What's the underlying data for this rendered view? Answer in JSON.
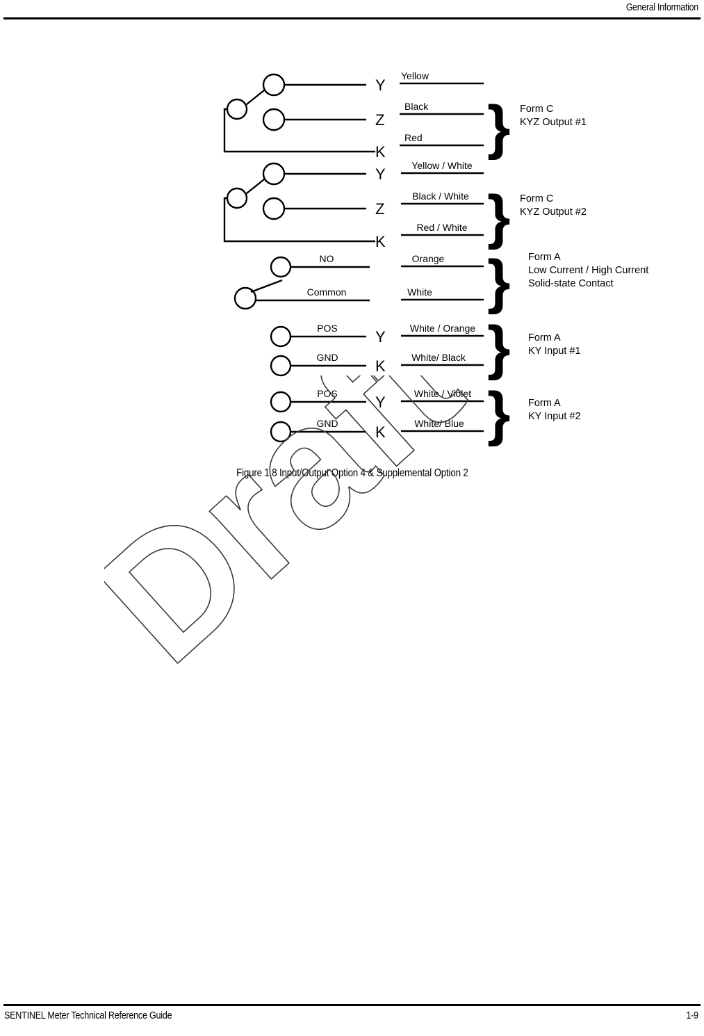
{
  "page": {
    "header_title": "General Information",
    "footer_left": "SENTINEL Meter Technical Reference Guide",
    "footer_page": "1-9",
    "watermark": "Draft"
  },
  "figure": {
    "caption": "Figure 1.8 Input/Output Option 4 & Supplemental Option 2",
    "groups": [
      {
        "id": "form-c-kyz-output-1",
        "switch_type": "form-c",
        "terminals": [
          "Y",
          "Z",
          "K"
        ],
        "pin_labels": [
          "",
          "",
          ""
        ],
        "wires": [
          "Yellow",
          "Black",
          "Red"
        ],
        "wire_align": "left",
        "group_label_lines": [
          "Form C",
          "KYZ Output #1"
        ]
      },
      {
        "id": "form-c-kyz-output-2",
        "switch_type": "form-c",
        "terminals": [
          "Y",
          "Z",
          "K"
        ],
        "pin_labels": [
          "",
          "",
          ""
        ],
        "wires": [
          "Yellow / White",
          "Black / White",
          "Red / White"
        ],
        "wire_align": "center",
        "group_label_lines": [
          "Form C",
          "KYZ Output #2"
        ]
      },
      {
        "id": "form-a-solid-state-contact",
        "switch_type": "form-a",
        "terminals": [
          "",
          ""
        ],
        "pin_labels": [
          "NO",
          "Common"
        ],
        "wires": [
          "Orange",
          "White"
        ],
        "wire_align": "center",
        "group_label_lines": [
          "Form A",
          "Low Current / High Current",
          "Solid-state Contact"
        ]
      },
      {
        "id": "form-a-ky-input-1",
        "switch_type": "input",
        "terminals": [
          "Y",
          "K"
        ],
        "pin_labels": [
          "POS",
          "GND"
        ],
        "wires": [
          "White / Orange",
          "White/ Black"
        ],
        "wire_align": "center",
        "group_label_lines": [
          "Form A",
          "KY Input #1"
        ]
      },
      {
        "id": "form-a-ky-input-2",
        "switch_type": "input",
        "terminals": [
          "Y",
          "K"
        ],
        "pin_labels": [
          "POS",
          "GND"
        ],
        "wires": [
          "White / Violet",
          "White/ Blue"
        ],
        "wire_align": "center",
        "group_label_lines": [
          "Form A",
          "KY Input #2"
        ]
      }
    ]
  },
  "colors": {
    "ink": "#000000",
    "paper": "#ffffff"
  }
}
